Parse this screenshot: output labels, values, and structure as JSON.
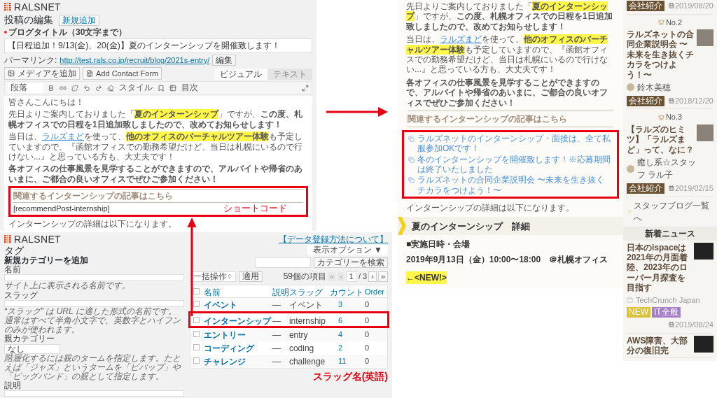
{
  "editor": {
    "logo": "RALSNET",
    "heading": "投稿の編集",
    "add_new": "新規追加",
    "title_label": "ブログタイトル（30文字まで）",
    "title_value": "【日程追加！9/13(金)、20(金)】夏のインターンシップを開催致します！",
    "permalink_label": "パーマリンク:",
    "permalink_url": "http://test.rals.co.jp/recruit/blog/2021s-entry/",
    "permalink_button": "編集",
    "media_button": "メディアを追加",
    "contact_button": "Add Contact Form",
    "tabs": [
      {
        "label": "ビジュアル",
        "selected": true
      },
      {
        "label": "テキスト",
        "selected": false
      }
    ],
    "format": "段落",
    "style": "スタイル",
    "toc": "目次",
    "paragraphs": [
      [
        {
          "kind": "plain",
          "text": "皆さんこんにちは！"
        }
      ],
      [
        {
          "kind": "plain",
          "text": "先日よりご案内しておりました「"
        },
        {
          "kind": "highlight",
          "text": "夏のインターンシップ"
        },
        {
          "kind": "plain",
          "text": "」ですが、"
        },
        {
          "kind": "bold",
          "text": "この度、札幌オフィスでの日程を1日追加致しましたので、改めてお知らせします！"
        }
      ],
      [
        {
          "kind": "plain",
          "text": "当日は、"
        },
        {
          "kind": "link",
          "text": "ラルズまど"
        },
        {
          "kind": "plain",
          "text": "を使って、"
        },
        {
          "kind": "highlight",
          "text": "他のオフィスのバーチャルツアー体験"
        },
        {
          "kind": "plain",
          "text": "も予定していますので、『函館オフィスでの勤務希望だけど、当日は札幌にいるので行けない...』と思っている方も、大丈夫です！"
        }
      ],
      [
        {
          "kind": "bold",
          "text": "各オフィスの仕事風景を見学することができますので、アルバイトや帰省のあいまに、ご都合の良いオフィスでぜひご参加ください！"
        }
      ]
    ],
    "related_heading": "関連するインターンシップの記事はこちら",
    "shortcode": "[recommendPost-internship]",
    "callout": "ショートコード",
    "closing": "インターンシップの詳細は以下になります。"
  },
  "blog": {
    "paragraphs": [
      [
        {
          "kind": "plain",
          "text": "先日よりご案内しておりました「"
        },
        {
          "kind": "highlight",
          "text": "夏のインターンシップ"
        },
        {
          "kind": "plain",
          "text": "」ですが、"
        },
        {
          "kind": "bold",
          "text": "この度、札幌オフィスでの日程を1日追加致しましたので、改めてお知らせします！"
        }
      ],
      [
        {
          "kind": "plain",
          "text": "当日は、"
        },
        {
          "kind": "link",
          "text": "ラルズまど"
        },
        {
          "kind": "plain",
          "text": "を使って、"
        },
        {
          "kind": "highlight",
          "text": "他のオフィスのバーチャルツアー体験"
        },
        {
          "kind": "plain",
          "text": "も予定していますので、『函館オフィスでの勤務希望だけど、当日は札幌にいるので行けない...』と思っている方も、大丈夫です！"
        }
      ],
      [
        {
          "kind": "bold",
          "text": "各オフィスの仕事風景を見学することができますので、アルバイトや帰省のあいまに、ご都合の良いオフィスでぜひご参加ください！"
        }
      ]
    ],
    "related_heading": "関連するインターンシップの記事はこちら",
    "related_links": [
      "ラルズネットのインターンシップ・面接は、全て私服参加OKです！",
      "冬のインターンシップを開催致します！※応募期間は終了いたしました",
      "ラルズネットの合同企業説明会 〜未来を生き抜くチカラをつけよう！〜"
    ],
    "closing": "インターンシップの詳細は以下になります。",
    "section_heading": "夏のインターンシップ　詳細",
    "schedule_label": "■実施日時・会場",
    "schedule": "2019年9月13日（金）10:00〜18:00　＠札幌オフィス",
    "new_badge": "←<NEW!>"
  },
  "sidebar": {
    "cards": [
      {
        "tag": {
          "label": "会社紹介",
          "color": "#6b5233"
        },
        "date": "2019/08/20"
      },
      {
        "rank": "No.2",
        "title": "ラルズネットの合同企業説明会 〜未来を生き抜くチカラをつけよう！〜",
        "author": "鈴木美穂",
        "tag": {
          "label": "会社紹介",
          "color": "#6b5233"
        },
        "date": "2018/12/20"
      },
      {
        "rank": "No.3",
        "title": "【ラルズのヒミツ】「ラルズまど」って、なに？",
        "author": "癒し系☆スタッフ ラル子",
        "tag": {
          "label": "会社紹介",
          "color": "#6b5233"
        },
        "date": "2019/02/15"
      }
    ],
    "more_link": "スタッフブログ一覧へ",
    "news_heading": "新着ニュース",
    "news": [
      {
        "title": "日本のispaceは2021年の月面着陸、2023年のローバー月探査を目指す",
        "source": "TechCrunch Japan",
        "tags": [
          {
            "label": "NEW",
            "color": "#dcc23c"
          },
          {
            "label": "IT全般",
            "color": "#a57fc8"
          }
        ],
        "date": "2019/08/24"
      },
      {
        "title": "AWS障害、大部分の復旧完"
      }
    ]
  },
  "admin": {
    "logo": "RALSNET",
    "help_link": "【データ登録方法について】",
    "screen_options": "表示オプション ▼",
    "heading": "タグ",
    "search_button": "カテゴリーを検索",
    "form_title": "新規カテゴリーを追加",
    "name_label": "名前",
    "name_hint": "サイト上に表示される名前です。",
    "slug_label": "スラッグ",
    "slug_hint": "“スラッグ” は URL に適した形式の名前です。通常はすべて半角小文字で、英数字とハイフンのみが使われます。",
    "parent_label": "親カテゴリー",
    "parent_value": "なし",
    "parent_hint": "階層化するには親のタームを指定します。たとえば「ジャズ」というタームを「ビバップ」や「ビッグバンド」の親として指定します。",
    "description_label": "説明",
    "bulk_action": "一括操作",
    "apply": "適用",
    "item_count": "59個の項目",
    "pager": [
      "«",
      "‹"
    ],
    "page": "1",
    "page_total": "/ 3",
    "pager_next": [
      "›",
      "»"
    ],
    "columns": [
      "名前",
      "説明",
      "スラッグ",
      "カウント",
      "Order"
    ],
    "header_checked": false,
    "rows": [
      {
        "name": "イベント",
        "description": "—",
        "slug": "イベント",
        "count": "3",
        "order": "0",
        "checked": false
      },
      {
        "name": "インターンシップ",
        "description": "—",
        "slug": "internship",
        "count": "6",
        "order": "0",
        "checked": false
      },
      {
        "name": "エントリー",
        "description": "—",
        "slug": "entry",
        "count": "4",
        "order": "0",
        "checked": false
      },
      {
        "name": "コーディング",
        "description": "—",
        "slug": "coding",
        "count": "2",
        "order": "0",
        "checked": false
      },
      {
        "name": "チャレンジ",
        "description": "—",
        "slug": "challenge",
        "count": "11",
        "order": "0",
        "checked": false
      }
    ],
    "callout": "スラッグ名(英語)"
  }
}
